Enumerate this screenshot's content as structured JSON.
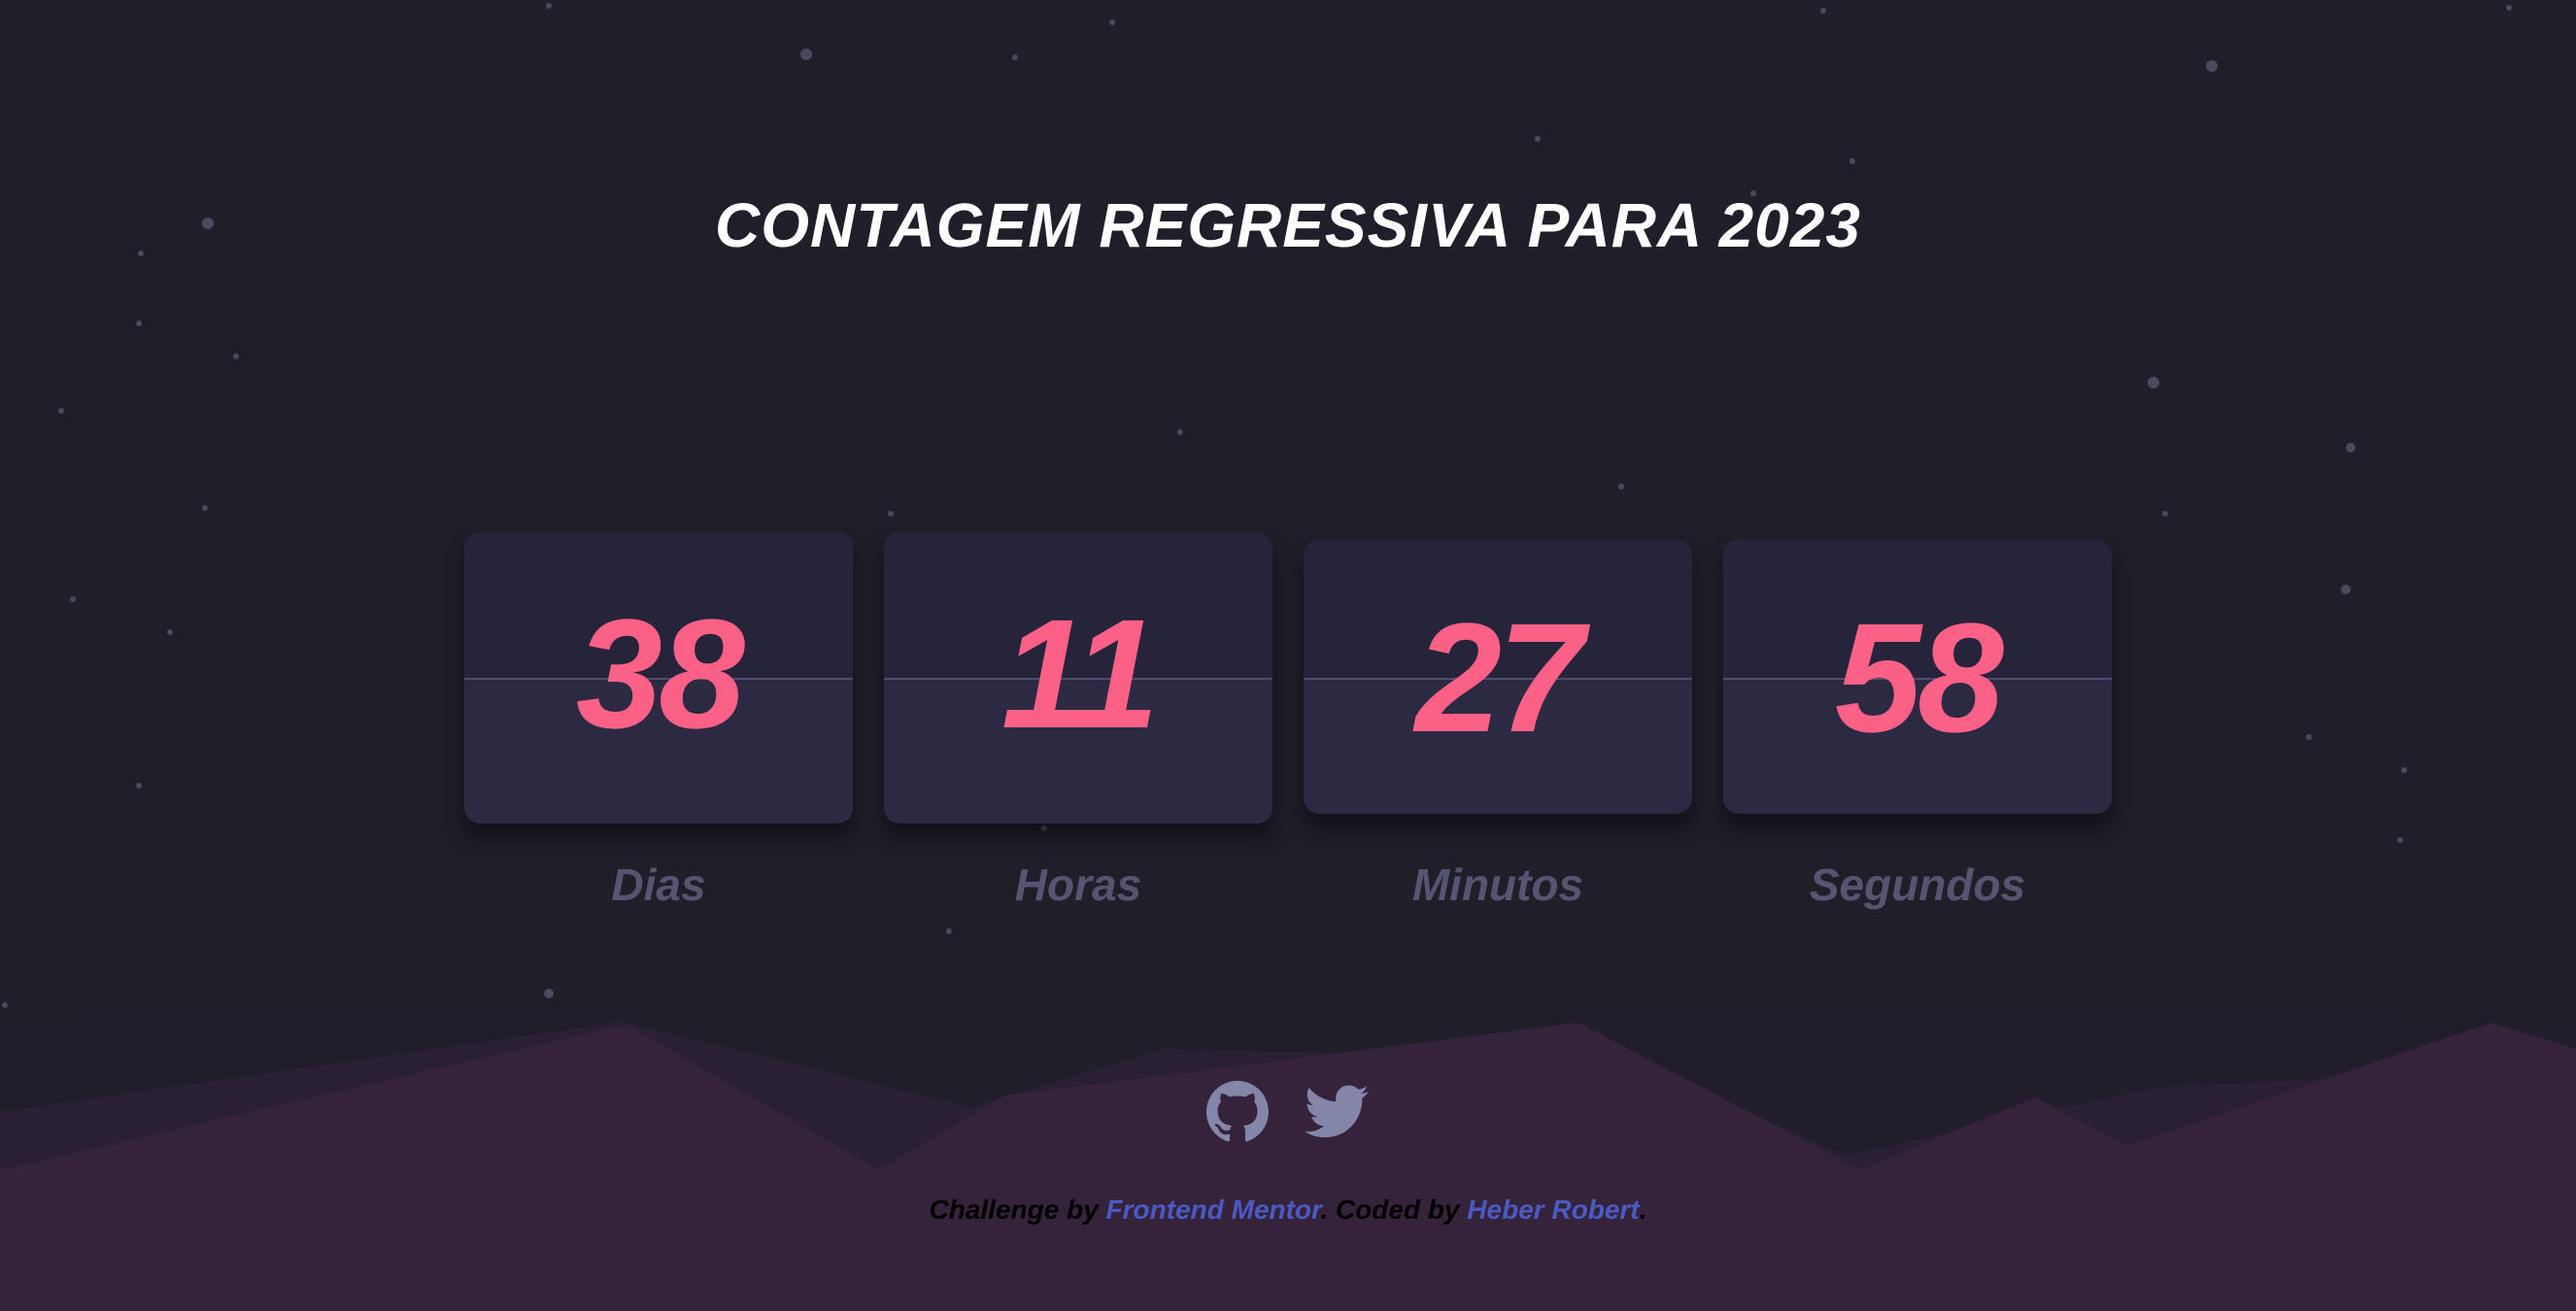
{
  "title": "CONTAGEM REGRESSIVA PARA 2023",
  "countdown": [
    {
      "value": "38",
      "label": "Dias"
    },
    {
      "value": "11",
      "label": "Horas"
    },
    {
      "value": "27",
      "label": "Minutos"
    },
    {
      "value": "58",
      "label": "Segundos"
    }
  ],
  "social": {
    "github_icon": "github-icon",
    "twitter_icon": "twitter-icon"
  },
  "footer": {
    "prefix": "Challenge by",
    "link1": "Frontend Mentor",
    "middle": ". Coded by",
    "link2": "Heber Robert",
    "suffix": "."
  },
  "colors": {
    "background": "#1f1e29",
    "number": "#fb6087",
    "label": "#555571",
    "hills": "#34233b",
    "link": "#4b5ac3",
    "icon": "#8385a9"
  }
}
